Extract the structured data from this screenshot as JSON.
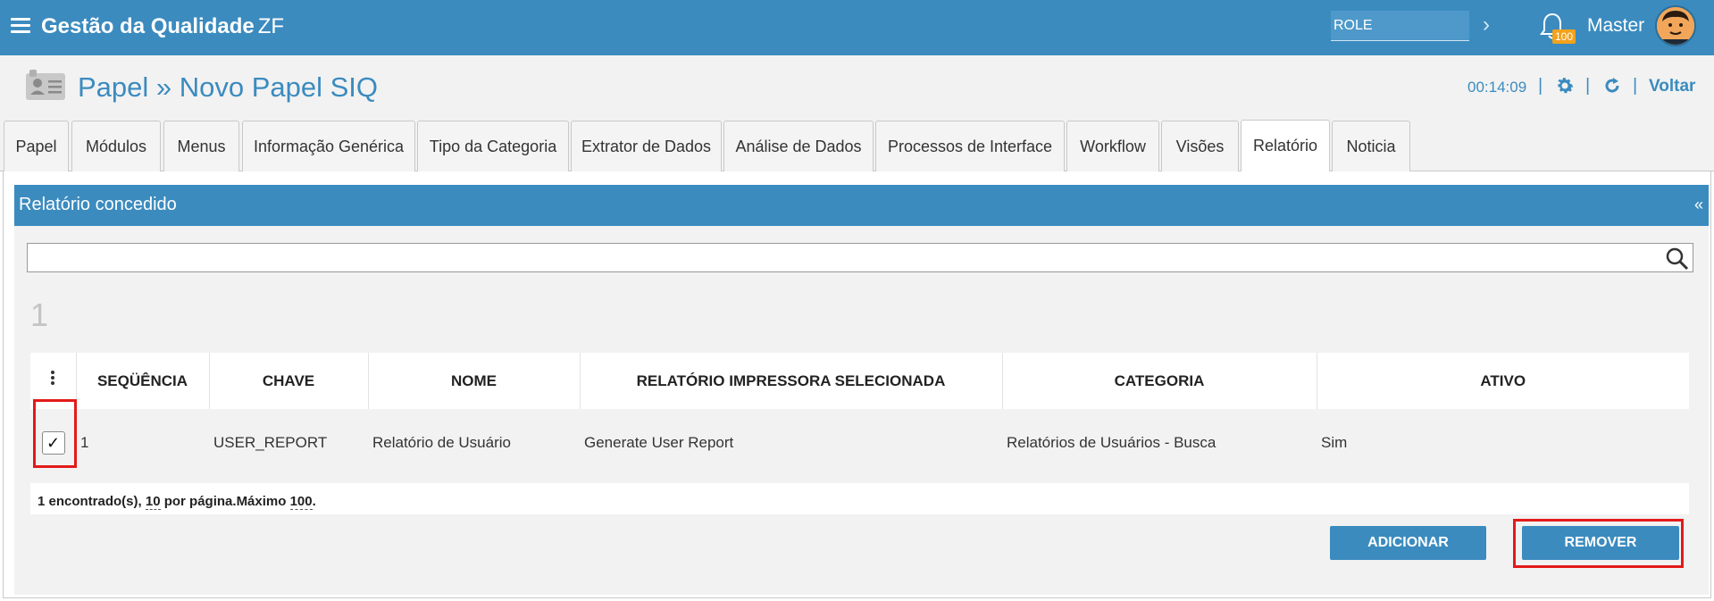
{
  "app": {
    "title": "Gestão da Qualidade",
    "suffix": "ZF"
  },
  "topbar": {
    "role_value": "ROLE",
    "notifications_count": "100",
    "user_name": "Master"
  },
  "header": {
    "title": "Papel » Novo Papel SIQ",
    "timer": "00:14:09",
    "back_label": "Voltar",
    "separator": "|"
  },
  "tabs": [
    {
      "label": "Papel"
    },
    {
      "label": "Módulos"
    },
    {
      "label": "Menus"
    },
    {
      "label": "Informação Genérica"
    },
    {
      "label": "Tipo da Categoria"
    },
    {
      "label": "Extrator de Dados"
    },
    {
      "label": "Análise de Dados"
    },
    {
      "label": "Processos de Interface"
    },
    {
      "label": "Workflow"
    },
    {
      "label": "Visões"
    },
    {
      "label": "Relatório",
      "active": true
    },
    {
      "label": "Noticia"
    }
  ],
  "panel": {
    "title": "Relatório concedido",
    "collapse_label": "«",
    "search_value": "",
    "record_count": "1",
    "table": {
      "headers": [
        "SEQÜÊNCIA",
        "CHAVE",
        "NOME",
        "RELATÓRIO IMPRESSORA SELECIONADA",
        "CATEGORIA",
        "ATIVO"
      ],
      "rows": [
        {
          "checked": true,
          "check_glyph": "✓",
          "cells": [
            "1",
            "USER_REPORT",
            "Relatório de Usuário",
            "Generate User Report",
            "Relatórios de Usuários - Busca",
            "Sim"
          ]
        }
      ]
    },
    "footer": {
      "found": "1 encontrado(s),",
      "per_page_value": "10",
      "per_page_text": "por página.",
      "max_label": "Máximo",
      "max_value": "100",
      "end": "."
    },
    "buttons": {
      "add": "ADICIONAR",
      "remove": "REMOVER"
    }
  },
  "colors": {
    "primary": "#3b8bbf",
    "highlight": "#e31a1a",
    "badge": "#f3a21c"
  }
}
